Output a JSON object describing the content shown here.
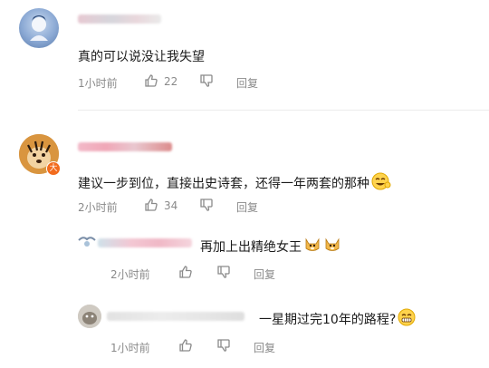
{
  "comments": [
    {
      "text": "真的可以说没让我失望",
      "time": "1小时前",
      "likes": "22",
      "reply_label": "回复"
    },
    {
      "text": "建议一步到位，直接出史诗套，还得一年两套的那种",
      "time": "2小时前",
      "likes": "34",
      "reply_label": "回复",
      "badge": "大",
      "replies": [
        {
          "text": "再加上出精绝女王",
          "time": "2小时前",
          "reply_label": "回复"
        },
        {
          "text": "一星期过完10年的路程?",
          "time": "1小时前",
          "reply_label": "回复"
        }
      ]
    }
  ],
  "colors": {
    "badge": "#f26b1d",
    "meta_text": "#8a8a8a",
    "divider": "#ececec"
  }
}
